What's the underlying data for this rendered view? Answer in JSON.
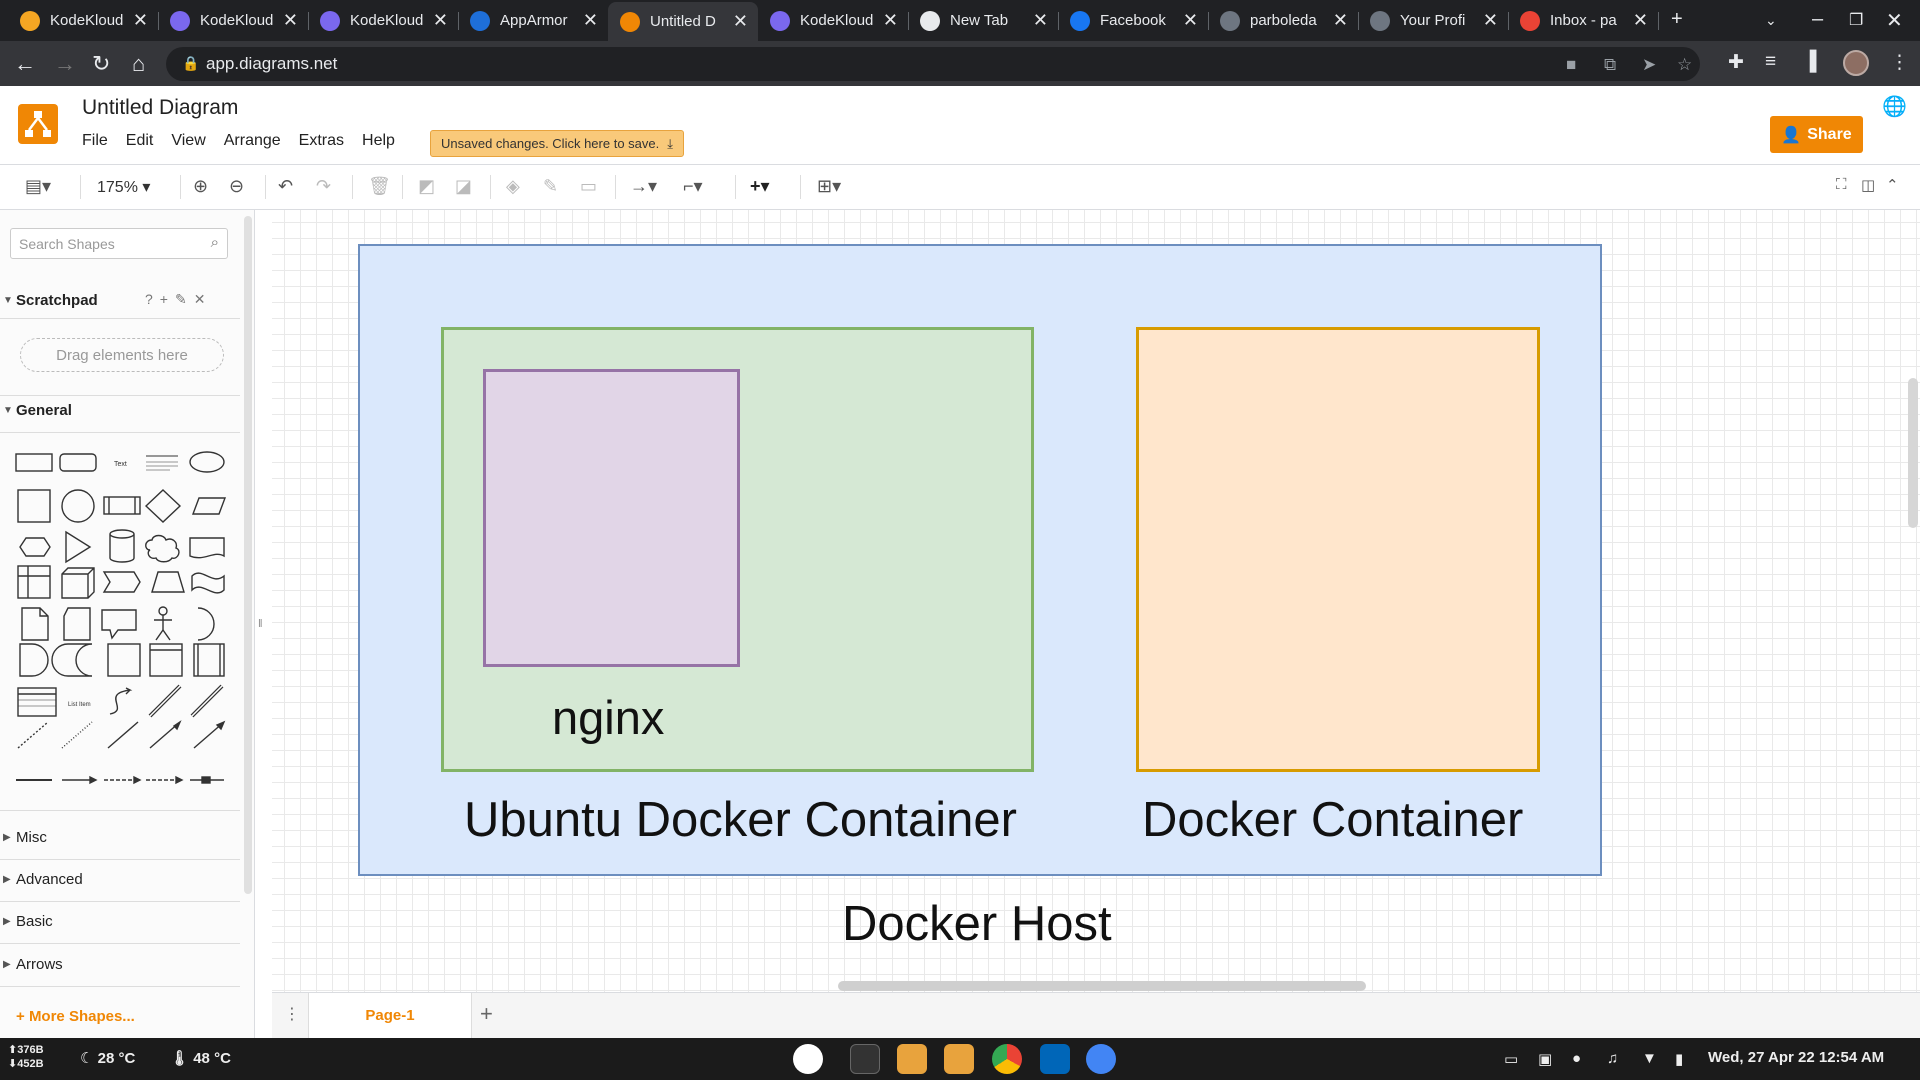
{
  "browser": {
    "tabs": [
      {
        "title": "KodeKloud",
        "favicon_color": "#f5a623",
        "active": false
      },
      {
        "title": "KodeKloud",
        "favicon_color": "#7b68ee",
        "active": false
      },
      {
        "title": "KodeKloud",
        "favicon_color": "#7b68ee",
        "active": false
      },
      {
        "title": "AppArmor",
        "favicon_color": "#1e6fd9",
        "active": false
      },
      {
        "title": "Untitled D",
        "favicon_color": "#f08705",
        "active": true
      },
      {
        "title": "KodeKloud",
        "favicon_color": "#7b68ee",
        "active": false
      },
      {
        "title": "New Tab",
        "favicon_color": "#e8eaed",
        "active": false
      },
      {
        "title": "Facebook",
        "favicon_color": "#1877f2",
        "active": false
      },
      {
        "title": "parboleda",
        "favicon_color": "#6e7681",
        "active": false
      },
      {
        "title": "Your Profi",
        "favicon_color": "#6e7681",
        "active": false
      },
      {
        "title": "Inbox - pa",
        "favicon_color": "#ea4335",
        "active": false
      }
    ],
    "url": "app.diagrams.net"
  },
  "app": {
    "title": "Untitled Diagram",
    "menu": [
      "File",
      "Edit",
      "View",
      "Arrange",
      "Extras",
      "Help"
    ],
    "unsaved_notice": "Unsaved changes. Click here to save.",
    "share_label": "Share"
  },
  "toolbar": {
    "zoom": "175%"
  },
  "sidebar": {
    "search_placeholder": "Search Shapes",
    "scratchpad_label": "Scratchpad",
    "dropzone_text": "Drag elements here",
    "general_label": "General",
    "collapsed_sections": [
      "Misc",
      "Advanced",
      "Basic",
      "Arrows"
    ],
    "more_shapes": "More Shapes..."
  },
  "diagram": {
    "host_label": "Docker Host",
    "ubuntu_label": "Ubuntu Docker Container",
    "nginx_label": "nginx",
    "container_label": "Docker Container",
    "colors": {
      "host_fill": "#dae8fc",
      "host_stroke": "#6c8ebf",
      "ubuntu_fill": "#d5e8d4",
      "ubuntu_stroke": "#82b366",
      "nginx_fill": "#e1d5e7",
      "nginx_stroke": "#9673a6",
      "container_fill": "#ffe6cc",
      "container_stroke": "#d79b00"
    }
  },
  "pages": {
    "current": "Page-1"
  },
  "taskbar": {
    "net_up": "376B",
    "net_down": "452B",
    "weather": "28 °C",
    "temp": "48 °C",
    "clock": "Wed, 27 Apr 22 12:54 AM"
  }
}
